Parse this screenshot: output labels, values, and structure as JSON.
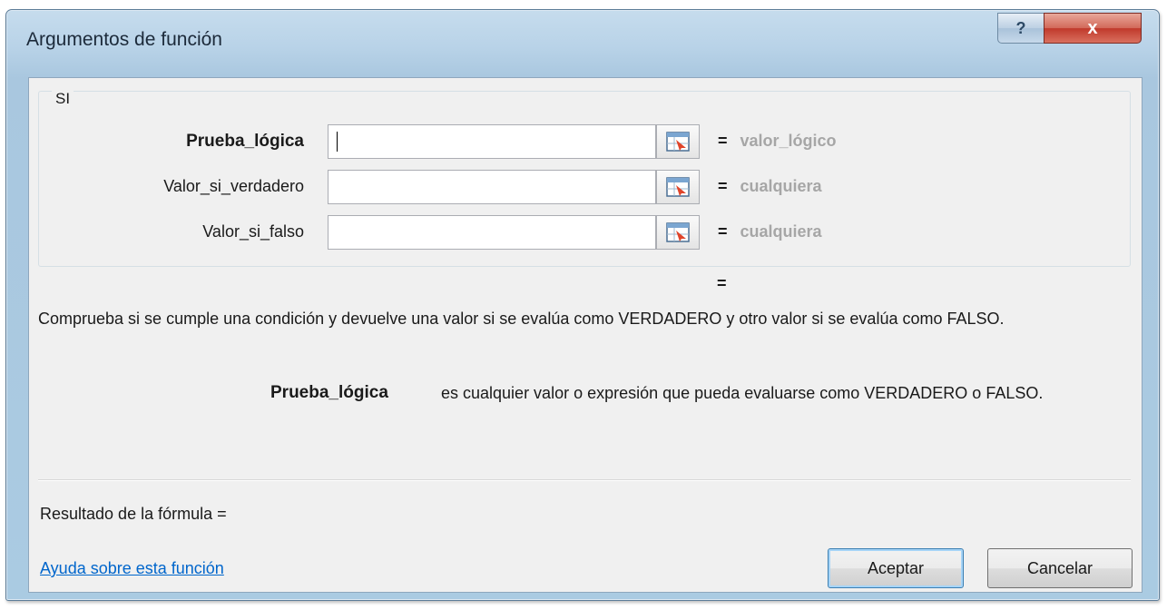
{
  "window": {
    "title": "Argumentos de función",
    "help_symbol": "?",
    "close_symbol": "x"
  },
  "group": {
    "label": "SI"
  },
  "arguments": [
    {
      "label": "Prueba_lógica",
      "value": "",
      "equals": "=",
      "result": "valor_lógico",
      "bold": true
    },
    {
      "label": "Valor_si_verdadero",
      "value": "",
      "equals": "=",
      "result": "cualquiera",
      "bold": false
    },
    {
      "label": "Valor_si_falso",
      "value": "",
      "equals": "=",
      "result": "cualquiera",
      "bold": false
    }
  ],
  "overall_equals": "=",
  "description": "Comprueba si se cumple una condición y devuelve una valor si se evalúa como VERDADERO y otro valor si se evalúa como FALSO.",
  "argument_help": {
    "name": "Prueba_lógica",
    "text": "es cualquier valor o expresión que pueda evaluarse como VERDADERO o FALSO."
  },
  "formula_result": "Resultado de la fórmula =",
  "help_link": "Ayuda sobre esta función",
  "buttons": {
    "ok": "Aceptar",
    "cancel": "Cancelar"
  }
}
